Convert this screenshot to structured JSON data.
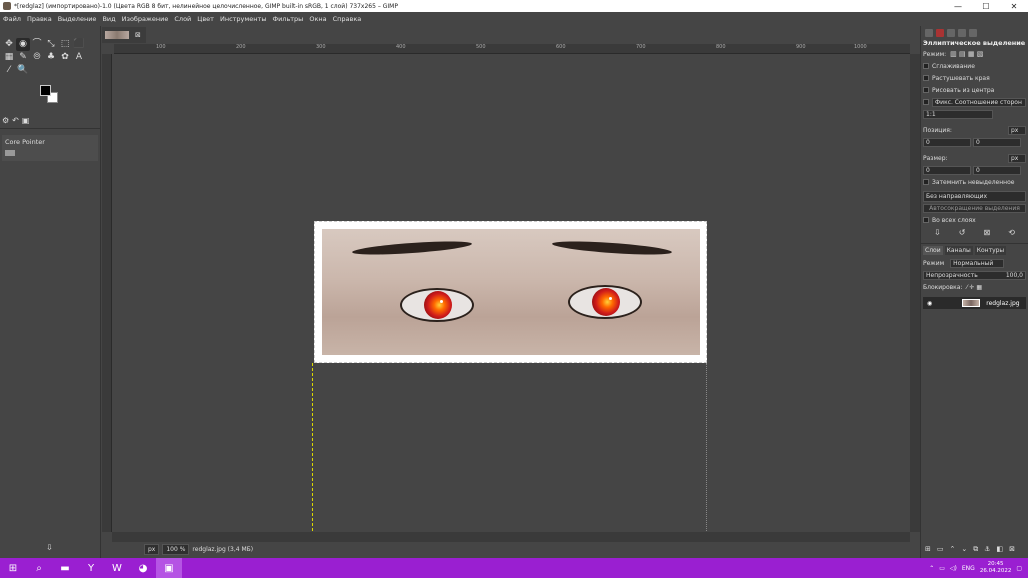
{
  "window": {
    "title": "*[redglaz] (импортировано)-1.0 (Цвета RGB 8 бит, нелинейное целочисленное, GIMP built-in sRGB, 1 слой) 737x265 – GIMP",
    "minimize": "—",
    "maximize": "☐",
    "close": "✕"
  },
  "menu": [
    "Файл",
    "Правка",
    "Выделение",
    "Вид",
    "Изображение",
    "Слой",
    "Цвет",
    "Инструменты",
    "Фильтры",
    "Окна",
    "Справка"
  ],
  "toolbox": {
    "tools": [
      "✥",
      "◉",
      "⌒",
      "⤡",
      "⬚",
      "⬛",
      "▦",
      "✎",
      "⦾",
      "♣",
      "✿",
      "A",
      "⁄",
      "🔍"
    ],
    "dock_label": "Core Pointer",
    "bottom_icon": "⇩"
  },
  "image_tab": {
    "close": "⊠"
  },
  "ruler_labels": [
    "100",
    "200",
    "300",
    "400",
    "500",
    "600",
    "700",
    "800",
    "900",
    "1000"
  ],
  "statusbar": {
    "unit": "px",
    "zoom": "100 %",
    "file_info": "redglaz.jpg (3,4 МБ)"
  },
  "tool_options": {
    "title": "Эллиптическое выделение",
    "mode_label": "Режим:",
    "antialias": "Сглаживание",
    "feather": "Растушевать края",
    "from_center": "Рисовать из центра",
    "fixed": "Фикс. Соотношение сторон",
    "ratio": "1:1",
    "position_label": "Позиция:",
    "position_unit": "px",
    "pos_x": "0",
    "pos_y": "0",
    "size_label": "Размер:",
    "size_unit": "px",
    "size_w": "0",
    "size_h": "0",
    "highlight": "Затемнить невыделенное",
    "guides": "Без направляющих",
    "autoshrink": "Автосокращение выделения",
    "merged": "Во всех слоях"
  },
  "layers": {
    "tabs": [
      "Слои",
      "Каналы",
      "Контуры"
    ],
    "mode_label": "Режим",
    "mode_value": "Нормальный",
    "opacity_label": "Непрозрачность",
    "opacity_value": "100,0",
    "lock_label": "Блокировка:",
    "layer_name": "redglaz.jpg"
  },
  "taskbar": {
    "apps": [
      "⊞",
      "⌕",
      "▬",
      "Y",
      "W",
      "◕",
      "▣"
    ],
    "lang": "ENG",
    "time": "20:45",
    "date": "26.04.2022"
  }
}
